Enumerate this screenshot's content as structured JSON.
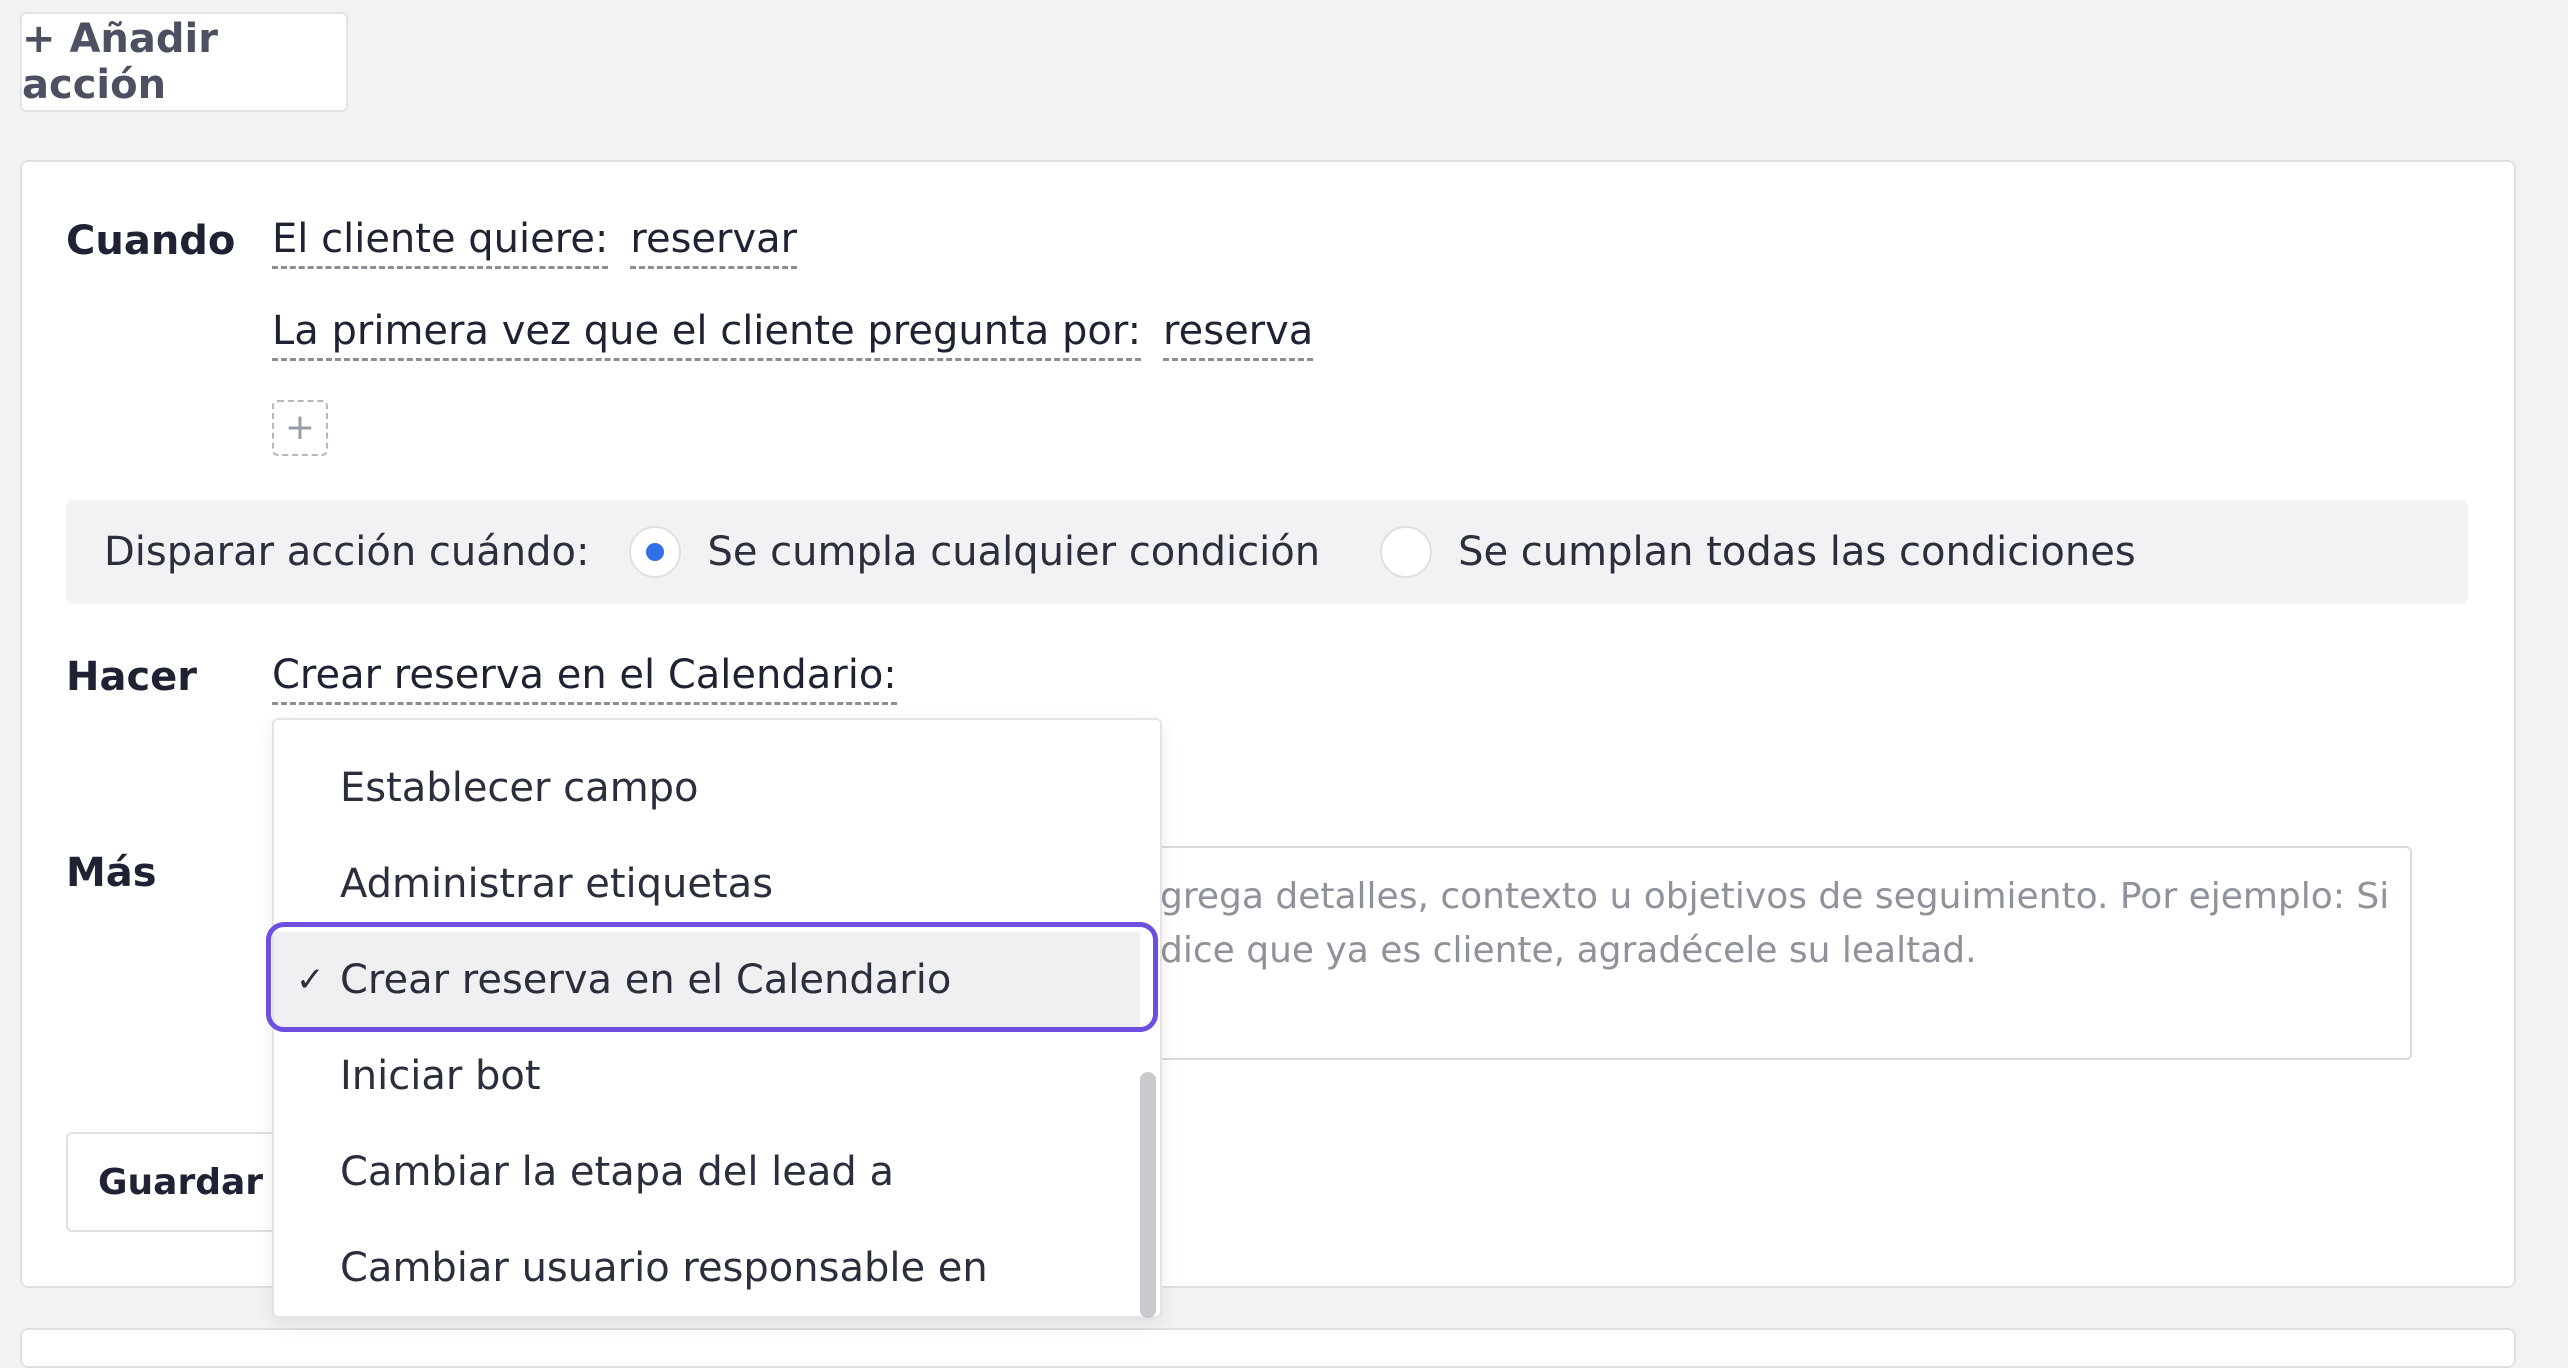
{
  "add_action_label": "+ Añadir acción",
  "when": {
    "label": "Cuando",
    "conditions": [
      {
        "prefix": "El cliente quiere:",
        "value": "reservar"
      },
      {
        "prefix": "La primera vez que el cliente pregunta por:",
        "value": "reserva"
      }
    ],
    "add_condition_symbol": "+"
  },
  "trigger": {
    "label": "Disparar acción cuándo:",
    "options": [
      {
        "label": "Se cumpla cualquier condición",
        "selected": true
      },
      {
        "label": "Se cumplan todas las condiciones",
        "selected": false
      }
    ]
  },
  "do": {
    "label": "Hacer",
    "selected_action": "Crear reserva en el Calendario:"
  },
  "more": {
    "label": "Más",
    "placeholder_visible": "grega detalles, contexto u objetivos de seguimiento. Por ejemplo: Si dice que ya es cliente, agradécele su lealtad."
  },
  "save_button_label": "Guardar acc",
  "dropdown": {
    "items": [
      {
        "label": "Establecer campo",
        "selected": false
      },
      {
        "label": "Administrar etiquetas",
        "selected": false
      },
      {
        "label": "Crear reserva en el Calendario",
        "selected": true
      },
      {
        "label": "Iniciar bot",
        "selected": false
      },
      {
        "label": "Cambiar la etapa del lead a",
        "selected": false
      },
      {
        "label": "Cambiar usuario responsable en",
        "selected": false
      }
    ],
    "check_symbol": "✓"
  },
  "colors": {
    "accent": "#2f6fe8",
    "highlight": "#6e4fe0"
  }
}
